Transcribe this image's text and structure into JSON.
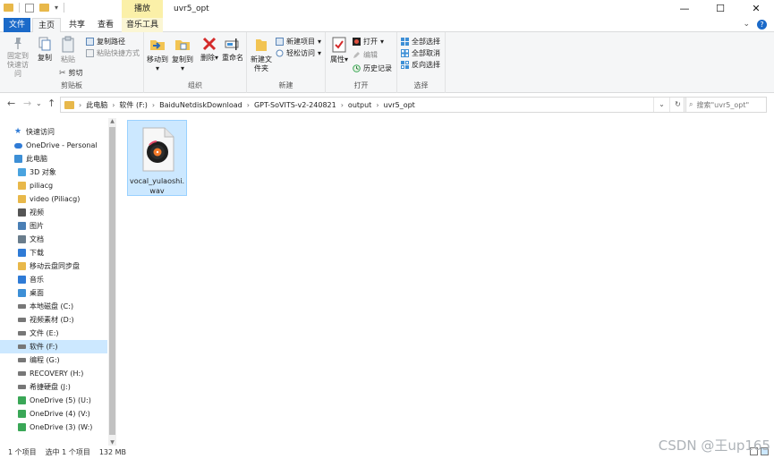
{
  "window": {
    "title": "uvr5_opt",
    "context_tab": "播放",
    "minimize": "—",
    "maximize": "☐",
    "close": "✕"
  },
  "tabs": {
    "file": "文件",
    "home": "主页",
    "share": "共享",
    "view": "查看",
    "music_tools": "音乐工具"
  },
  "ribbon": {
    "clipboard": {
      "label": "剪贴板",
      "pin": "固定到快速访问",
      "copy": "复制",
      "paste": "粘贴",
      "copy_path": "复制路径",
      "paste_shortcut": "粘贴快捷方式",
      "cut": "剪切"
    },
    "organize": {
      "label": "组织",
      "move_to": "移动到",
      "copy_to": "复制到",
      "delete": "删除",
      "rename": "重命名"
    },
    "new": {
      "label": "新建",
      "new_folder": "新建文件夹",
      "new_item": "新建项目",
      "easy_access": "轻松访问"
    },
    "open": {
      "label": "打开",
      "properties": "属性",
      "open": "打开",
      "edit": "编辑",
      "history": "历史记录"
    },
    "select": {
      "label": "选择",
      "select_all": "全部选择",
      "select_none": "全部取消",
      "invert": "反向选择"
    }
  },
  "address": {
    "crumbs": [
      "此电脑",
      "软件 (F:)",
      "BaiduNetdiskDownload",
      "GPT-SoVITS-v2-240821",
      "output",
      "uvr5_opt"
    ],
    "search_placeholder": "搜索\"uvr5_opt\""
  },
  "nav": {
    "items": [
      {
        "label": "快速访问",
        "icon": "star-icon",
        "color": "#2f7bd6",
        "indent": 0,
        "selected": false
      },
      {
        "label": "OneDrive - Personal",
        "icon": "cloud-icon",
        "color": "#2f7bd6",
        "indent": 0,
        "selected": false
      },
      {
        "label": "此电脑",
        "icon": "computer-icon",
        "color": "#3d8fd6",
        "indent": 0,
        "selected": false
      },
      {
        "label": "3D 对象",
        "icon": "cube-icon",
        "color": "#4aa3df",
        "indent": 1,
        "selected": false
      },
      {
        "label": "piliacg",
        "icon": "user-folder-icon",
        "color": "#e8b84a",
        "indent": 1,
        "selected": false
      },
      {
        "label": "video (Piliacg)",
        "icon": "user-folder-icon",
        "color": "#e8b84a",
        "indent": 1,
        "selected": false
      },
      {
        "label": "视频",
        "icon": "video-icon",
        "color": "#555555",
        "indent": 1,
        "selected": false
      },
      {
        "label": "图片",
        "icon": "picture-icon",
        "color": "#4a7fb5",
        "indent": 1,
        "selected": false
      },
      {
        "label": "文档",
        "icon": "document-icon",
        "color": "#6a7d8c",
        "indent": 1,
        "selected": false
      },
      {
        "label": "下载",
        "icon": "download-icon",
        "color": "#2f7bd6",
        "indent": 1,
        "selected": false
      },
      {
        "label": "移动云盘同步盘",
        "icon": "sync-folder-icon",
        "color": "#e8b84a",
        "indent": 1,
        "selected": false
      },
      {
        "label": "音乐",
        "icon": "music-icon",
        "color": "#2f7bd6",
        "indent": 1,
        "selected": false
      },
      {
        "label": "桌面",
        "icon": "desktop-icon",
        "color": "#3d8fd6",
        "indent": 1,
        "selected": false
      },
      {
        "label": "本地磁盘 (C:)",
        "icon": "drive-icon",
        "color": "#777777",
        "indent": 1,
        "selected": false
      },
      {
        "label": "视频素材 (D:)",
        "icon": "drive-icon",
        "color": "#777777",
        "indent": 1,
        "selected": false
      },
      {
        "label": "文件 (E:)",
        "icon": "drive-icon",
        "color": "#777777",
        "indent": 1,
        "selected": false
      },
      {
        "label": "软件 (F:)",
        "icon": "drive-icon",
        "color": "#777777",
        "indent": 1,
        "selected": true
      },
      {
        "label": "编程 (G:)",
        "icon": "drive-icon",
        "color": "#777777",
        "indent": 1,
        "selected": false
      },
      {
        "label": "RECOVERY (H:)",
        "icon": "drive-icon",
        "color": "#777777",
        "indent": 1,
        "selected": false
      },
      {
        "label": "希捷硬盘 (J:)",
        "icon": "drive-icon",
        "color": "#777777",
        "indent": 1,
        "selected": false
      },
      {
        "label": "OneDrive (5) (U:)",
        "icon": "onedrive-drive-icon",
        "color": "#3aa757",
        "indent": 1,
        "selected": false
      },
      {
        "label": "OneDrive (4) (V:)",
        "icon": "onedrive-drive-icon",
        "color": "#3aa757",
        "indent": 1,
        "selected": false
      },
      {
        "label": "OneDrive (3) (W:)",
        "icon": "onedrive-drive-icon",
        "color": "#3aa757",
        "indent": 1,
        "selected": false
      }
    ]
  },
  "files": [
    {
      "name_line1": "vocal_yulaoshi.",
      "name_line2": "wav",
      "icon": "audio-file-icon",
      "selected": true
    }
  ],
  "status": {
    "count": "1 个项目",
    "selected": "选中 1 个项目",
    "size": "132 MB"
  },
  "watermark": "CSDN @王up165"
}
